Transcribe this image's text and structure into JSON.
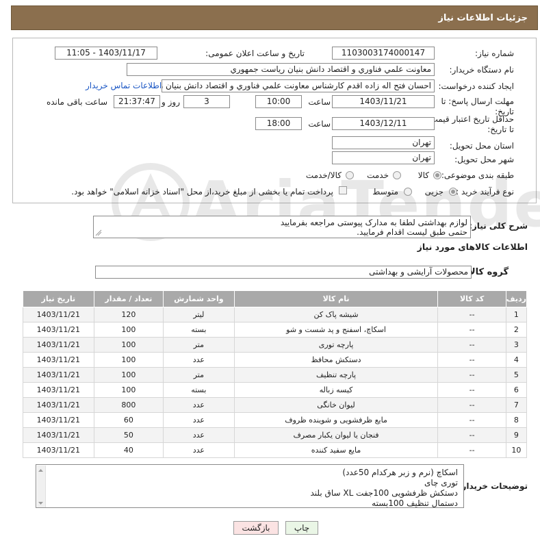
{
  "header": {
    "title": "جزئیات اطلاعات نیاز"
  },
  "form": {
    "need_number": {
      "label": "شماره نیاز:",
      "value": "1103003174000147"
    },
    "announce_datetime": {
      "label": "تاریخ و ساعت اعلان عمومی:",
      "value": "1403/11/17 - 11:05"
    },
    "buyer_org": {
      "label": "نام دستگاه خریدار:",
      "value": "معاونت علمي فناوري و اقتصاد دانش بنيان رياست جمهوري"
    },
    "requester": {
      "label": "ایجاد کننده درخواست:",
      "value": "احسان فتح اله زاده اقدم کارشناس معاونت علمي فناوري و اقتصاد دانش بنيان رياست جمهوري",
      "contact_link": "اطلاعات تماس خریدار"
    },
    "reply_deadline": {
      "label": "مهلت ارسال پاسخ: تا تاریخ:",
      "date": "1403/11/21",
      "time_label": "ساعت",
      "time": "10:00",
      "days": "3",
      "days_label": "روز و",
      "remaining": "21:37:47",
      "remaining_label": "ساعت باقی مانده"
    },
    "price_validity": {
      "label": "حداقل تاریخ اعتبار قیمت: تا تاریخ:",
      "date": "1403/12/11",
      "time_label": "ساعت",
      "time": "18:00"
    },
    "province": {
      "label": "استان محل تحویل:",
      "value": "تهران"
    },
    "city": {
      "label": "شهر محل تحویل:",
      "value": "تهران"
    },
    "category": {
      "label": "طبقه بندی موضوعی:",
      "options": [
        "کالا",
        "خدمت",
        "کالا/خدمت"
      ],
      "selected": "کالا"
    },
    "purchase_type": {
      "label": "نوع فرآیند خرید :",
      "options": [
        "جزیی",
        "متوسط"
      ],
      "selected": "جزیی",
      "note": "پرداخت تمام یا بخشی از مبلغ خرید،از محل \"اسناد خزانه اسلامی\" خواهد بود."
    }
  },
  "summary": {
    "label": "شرح کلی نیاز:",
    "line1": "لوازم بهداشتی لطفا به مدارک پیوستی مراجعه بفرمایید",
    "line2": "حتمی طبق لیست اقدام فرمایید."
  },
  "goods": {
    "section_title": "اطلاعات کالاهای مورد نیاز",
    "group_label": "گروه کالا:",
    "group_value": "محصولات آرایشی و بهداشتی",
    "columns": [
      "ردیف",
      "کد کالا",
      "نام کالا",
      "واحد شمارش",
      "تعداد / مقدار",
      "تاریخ نیاز"
    ],
    "rows": [
      [
        "1",
        "--",
        "شیشه پاک کن",
        "لیتر",
        "120",
        "1403/11/21"
      ],
      [
        "2",
        "--",
        "اسکاچ، اسفنج و پد شست و شو",
        "بسته",
        "100",
        "1403/11/21"
      ],
      [
        "3",
        "--",
        "پارچه توری",
        "متر",
        "100",
        "1403/11/21"
      ],
      [
        "4",
        "--",
        "دستکش محافظ",
        "عدد",
        "100",
        "1403/11/21"
      ],
      [
        "5",
        "--",
        "پارچه تنظیف",
        "متر",
        "100",
        "1403/11/21"
      ],
      [
        "6",
        "--",
        "کیسه زباله",
        "بسته",
        "100",
        "1403/11/21"
      ],
      [
        "7",
        "--",
        "لیوان خانگی",
        "عدد",
        "800",
        "1403/11/21"
      ],
      [
        "8",
        "--",
        "مایع ظرفشویی و شوینده ظروف",
        "عدد",
        "60",
        "1403/11/21"
      ],
      [
        "9",
        "--",
        "فنجان یا لیوان یکبار مصرف",
        "عدد",
        "50",
        "1403/11/21"
      ],
      [
        "10",
        "--",
        "مایع سفید کننده",
        "عدد",
        "40",
        "1403/11/21"
      ]
    ]
  },
  "buyer_notes": {
    "label": "توضیحات خریدار:",
    "lines": [
      "اسکاچ (نرم و زبر هرکدام 50عدد)",
      "توری چای",
      "دستکش ظرفشویی 100جفت XL ساق بلند",
      "دستمال تنظیف 100بسته"
    ]
  },
  "buttons": {
    "print": "چاپ",
    "back": "بازگشت"
  },
  "watermark": {
    "text": "AriaTender.neT"
  },
  "colors": {
    "header_bg": "#8b6f4e",
    "table_header_bg": "#a9a9a9",
    "link": "#1a56c4"
  }
}
